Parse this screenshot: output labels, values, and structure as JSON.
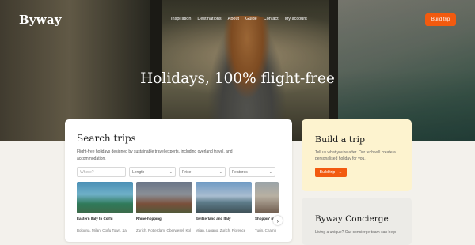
{
  "header": {
    "logo": "Byway",
    "nav": [
      "Inspiration",
      "Destinations",
      "About",
      "Guide",
      "Contact",
      "My account"
    ],
    "build_button": "Build trip"
  },
  "hero": {
    "title": "Holidays, 100% flight-free"
  },
  "search": {
    "title": "Search trips",
    "description": "Flight-free holidays designed by sustainable travel experts, including overland travel, and accommodation.",
    "where_placeholder": "Where?",
    "length_label": "Length",
    "price_label": "Price",
    "features_label": "Features",
    "trips": [
      {
        "name": "Eastern Italy to Corfu",
        "stops": "Bologna, Milan, Corfu Town, Za",
        "image_colors": [
          "#4a8fb5",
          "#2f7a5a"
        ]
      },
      {
        "name": "Rhine-hopping",
        "stops": "Zurich, Rotterdam, Oberwesel, Kol",
        "image_colors": [
          "#6a7588",
          "#7a4f3a"
        ]
      },
      {
        "name": "Switzerland and Italy",
        "stops": "Milan, Lugano, Zurich, Florence",
        "image_colors": [
          "#6f9ac4",
          "#5d7c8a"
        ]
      },
      {
        "name": "Shoppin' in",
        "stops": "Turin, Chamb",
        "image_colors": [
          "#9aa3a8",
          "#6e5b4d"
        ]
      }
    ],
    "next_icon": "chevron-right-icon"
  },
  "build_card": {
    "title": "Build a trip",
    "description": "Tell us what you're after. Our tech will create a personalised holiday for you.",
    "button": "Build trip",
    "button_icon": "arrow-right-icon"
  },
  "concierge": {
    "title": "Byway Concierge",
    "description": "Living a unique? Our concierge team can help"
  },
  "colors": {
    "accent": "#f25a0f",
    "build_card_bg": "#fdf3cf",
    "concierge_bg": "#ecebe7"
  }
}
